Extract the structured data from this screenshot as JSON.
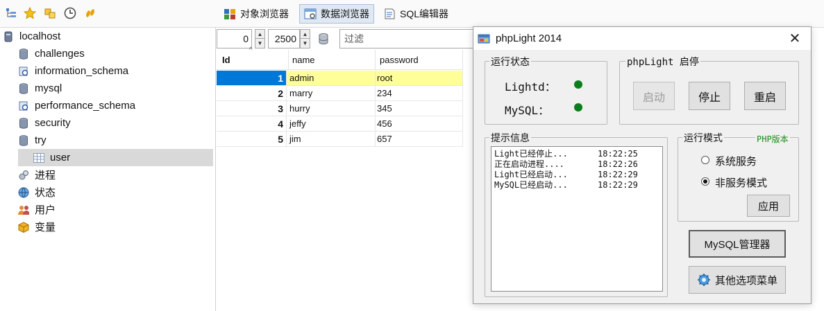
{
  "toolbar": {
    "icons": [
      "tree-view-icon",
      "favorites-star-icon",
      "connection-icon",
      "clock-history-icon",
      "footsteps-icon"
    ],
    "tabs": [
      {
        "label": "对象浏览器",
        "icon": "object-browser-icon"
      },
      {
        "label": "数据浏览器",
        "icon": "data-browser-icon",
        "active": true
      },
      {
        "label": "SQL编辑器",
        "icon": "sql-editor-icon"
      }
    ]
  },
  "tree": {
    "server": "localhost",
    "databases": [
      "challenges",
      "information_schema",
      "mysql",
      "performance_schema",
      "security",
      "try"
    ],
    "selected_table": "user",
    "extras": [
      "进程",
      "状态",
      "用户",
      "变量"
    ]
  },
  "filter_row": {
    "offset": "0",
    "limit": "2500",
    "filter_placeholder": "过滤"
  },
  "grid": {
    "columns": [
      "Id",
      "name",
      "password"
    ],
    "rows": [
      {
        "id": "1",
        "name": "admin",
        "password": "root"
      },
      {
        "id": "2",
        "name": "marry",
        "password": "234"
      },
      {
        "id": "3",
        "name": "hurry",
        "password": "345"
      },
      {
        "id": "4",
        "name": "jeffy",
        "password": "456"
      },
      {
        "id": "5",
        "name": "jim",
        "password": "657"
      }
    ]
  },
  "dialog": {
    "title": "phpLight 2014",
    "status_group": "运行状态",
    "lightd_label": "Lightd：",
    "mysql_label": "MySQL：",
    "control_group": "phpLight 启停",
    "start_label": "启动",
    "stop_label": "停止",
    "restart_label": "重启",
    "info_group": "提示信息",
    "log": [
      {
        "msg": "Light已经停止...",
        "time": "18:22:25"
      },
      {
        "msg": "正在启动进程....",
        "time": "18:22:26"
      },
      {
        "msg": "Light已经启动...",
        "time": "18:22:29"
      },
      {
        "msg": "MySQL已经启动...",
        "time": "18:22:29"
      }
    ],
    "mode_group": "运行模式",
    "php_version_link": "PHP版本",
    "mode_options": [
      "系统服务",
      "非服务模式"
    ],
    "mode_selected": "非服务模式",
    "apply_label": "应用",
    "mysql_manager_label": "MySQL管理器",
    "more_options_label": "其他选项菜单",
    "status_color": "#0c7d1c",
    "php_link_color": "#1a8a1a"
  }
}
